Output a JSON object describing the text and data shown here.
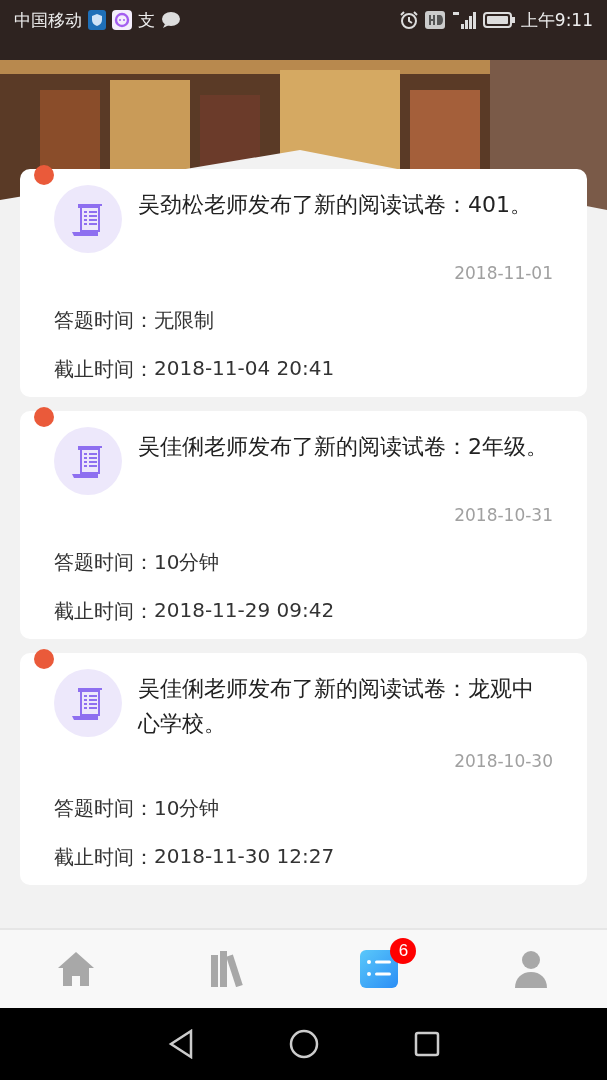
{
  "status_bar": {
    "carrier": "中国移动",
    "app_glyph": "支",
    "time": "上午9:11"
  },
  "notices": [
    {
      "unread": true,
      "title": "吴劲松老师发布了新的阅读试卷：401。",
      "date": "2018-11-01",
      "answer_time_label": "答题时间：",
      "answer_time": "无限制",
      "deadline_label": "截止时间：",
      "deadline": "2018-11-04 20:41"
    },
    {
      "unread": true,
      "title": "吴佳俐老师发布了新的阅读试卷：2年级。",
      "date": "2018-10-31",
      "answer_time_label": "答题时间：",
      "answer_time": "10分钟",
      "deadline_label": "截止时间：",
      "deadline": "2018-11-29 09:42"
    },
    {
      "unread": true,
      "title": "吴佳俐老师发布了新的阅读试卷：龙观中心学校。",
      "date": "2018-10-30",
      "answer_time_label": "答题时间：",
      "answer_time": "10分钟",
      "deadline_label": "截止时间：",
      "deadline": "2018-11-30 12:27"
    }
  ],
  "tab_bar": [
    {
      "kind": "home",
      "selected": false
    },
    {
      "kind": "books",
      "selected": false
    },
    {
      "kind": "list",
      "selected": true,
      "badge": "6"
    },
    {
      "kind": "person",
      "selected": false
    }
  ]
}
